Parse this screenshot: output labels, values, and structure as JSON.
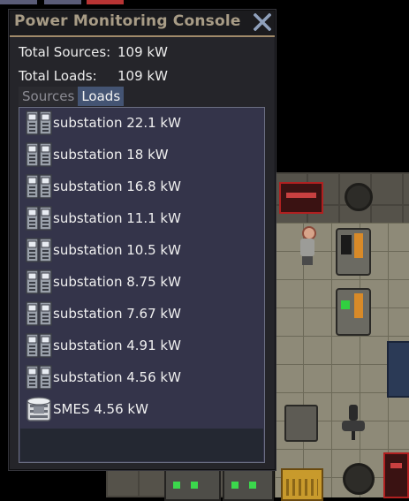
{
  "window": {
    "title": "Power Monitoring Console",
    "close_icon": "close-icon"
  },
  "summary": {
    "sources_label": "Total Sources:",
    "sources_value": "109 kW",
    "loads_label": "Total Loads:",
    "loads_value": "109 kW"
  },
  "tabs": {
    "sources": "Sources",
    "loads": "Loads",
    "active": "Loads"
  },
  "loads_list": [
    {
      "icon": "substation-icon",
      "label": "substation 22.1 kW"
    },
    {
      "icon": "substation-icon",
      "label": "substation 18 kW"
    },
    {
      "icon": "substation-icon",
      "label": "substation 16.8 kW"
    },
    {
      "icon": "substation-icon",
      "label": "substation 11.1 kW"
    },
    {
      "icon": "substation-icon",
      "label": "substation 10.5 kW"
    },
    {
      "icon": "substation-icon",
      "label": "substation 8.75 kW"
    },
    {
      "icon": "substation-icon",
      "label": "substation 7.67 kW"
    },
    {
      "icon": "substation-icon",
      "label": "substation 4.91 kW"
    },
    {
      "icon": "substation-icon",
      "label": "substation 4.56 kW"
    },
    {
      "icon": "smes-icon",
      "label": "SMES 4.56 kW"
    }
  ],
  "colors": {
    "window_bg": "#25252a",
    "title_text": "#a89c86",
    "title_underline": "#a08a6a",
    "active_tab": "#445473",
    "list_bg": "#34344a",
    "close_icon": "#8fa0bb"
  }
}
